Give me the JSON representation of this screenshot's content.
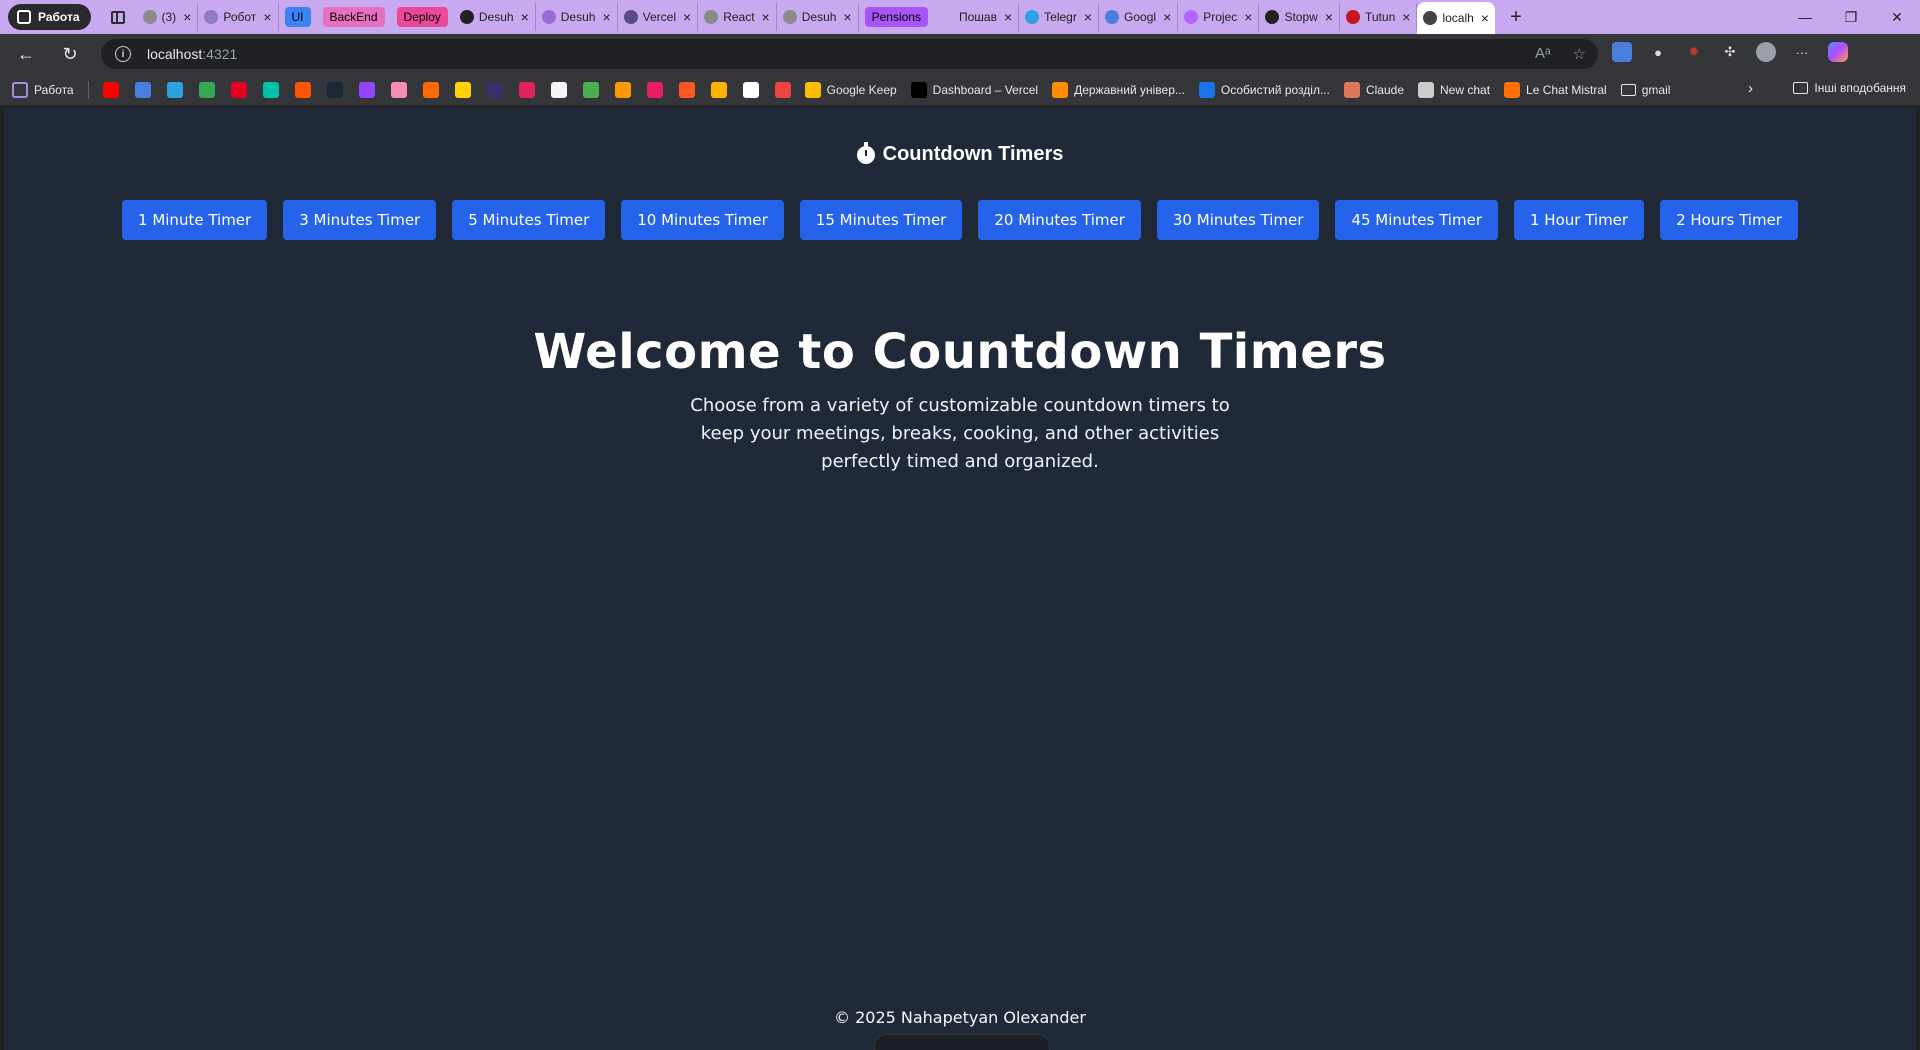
{
  "browser": {
    "workspace_label": "Работа",
    "tabs": [
      {
        "title": "(3)",
        "color": "#8a8a8a"
      },
      {
        "title": "Робот",
        "color": "#8e7cc3"
      },
      {
        "group": "UI",
        "group_color": "#3b82f6"
      },
      {
        "group": "BackEnd",
        "group_color": "#e76fbf"
      },
      {
        "group": "Deploy",
        "group_color": "#ec4899"
      },
      {
        "title": "Desuh",
        "color": "#222222"
      },
      {
        "title": "Desuh",
        "color": "#9d6bd6"
      },
      {
        "title": "Vercel",
        "color": "#5b4a8a"
      },
      {
        "title": "React",
        "color": "#8a8a8a"
      },
      {
        "title": "Desuh",
        "color": "#8a8a8a"
      },
      {
        "group": "Pensions",
        "group_color": "#a855f7"
      },
      {
        "title": "Пошав",
        "color": "#c8a9ef"
      },
      {
        "title": "Telegr",
        "color": "#2aa3e0"
      },
      {
        "title": "Googl",
        "color": "#4a7fe0"
      },
      {
        "title": "Projec",
        "color": "#b565ff"
      },
      {
        "title": "Stopw",
        "color": "#222222"
      },
      {
        "title": "Tutun",
        "color": "#c4161c"
      },
      {
        "title": "localh",
        "color": "#444444",
        "active": true
      }
    ],
    "new_tab": "+",
    "window_controls": {
      "minimize": "—",
      "restore": "❐",
      "close": "✕"
    },
    "url_host": "localhost",
    "url_port": ":4321"
  },
  "bookmarks": {
    "workspace": "Работа",
    "icon_colors": [
      "#ff0000",
      "#4a7fe0",
      "#2aa3e0",
      "#34a853",
      "#e60023",
      "#00c2a8",
      "#ff5500",
      "#1b2838",
      "#9146ff",
      "#f48fb1",
      "#ff6a00",
      "#ffd200",
      "#3b2f6b",
      "#e0245e",
      "#f5f5f5",
      "#4caf50",
      "#ff9800",
      "#e91e63",
      "#ff5722",
      "#ffb300",
      "#ffffff",
      "#ef4444"
    ],
    "items": [
      {
        "label": "Google Keep",
        "color": "#fbbc04"
      },
      {
        "label": "Dashboard – Vercel",
        "color": "#000000"
      },
      {
        "label": "Державний універ...",
        "color": "#ff8c00"
      },
      {
        "label": "Особистий розділ...",
        "color": "#1a73e8"
      },
      {
        "label": "Claude",
        "color": "#d97757"
      },
      {
        "label": "New chat",
        "color": "#cccccc"
      },
      {
        "label": "Le Chat Mistral",
        "color": "#ff7000"
      },
      {
        "label": "gmail",
        "color": "folder"
      }
    ],
    "other": "Інші вподобання"
  },
  "site": {
    "brand": "Countdown Timers",
    "timers": [
      "1 Minute Timer",
      "3 Minutes Timer",
      "5 Minutes Timer",
      "10 Minutes Timer",
      "15 Minutes Timer",
      "20 Minutes Timer",
      "30 Minutes Timer",
      "45 Minutes Timer",
      "1 Hour Timer",
      "2 Hours Timer"
    ],
    "hero_title": "Welcome to Countdown Timers",
    "hero_text": "Choose from a variety of customizable countdown timers to keep your meetings, breaks, cooking, and other activities perfectly timed and organized.",
    "footer": "© 2025 Nahapetyan Olexander"
  },
  "colors": {
    "accent": "#2563eb",
    "page_bg": "#1f2937",
    "tabstrip": "#c8a9ef"
  }
}
